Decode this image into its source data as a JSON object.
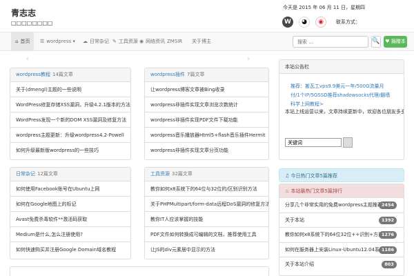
{
  "header": {
    "site_title": "青志志",
    "site_desc": "□□□□□□□□",
    "date_text": "今天是 2015 年 06 月 11 日，星期四",
    "social_label": "联系方式：",
    "social_icons": [
      "wordpress-icon",
      "qq-icon",
      "weibo-icon"
    ]
  },
  "nav": {
    "items": [
      {
        "label": "首页",
        "icon": "⌂"
      },
      {
        "label": "wordpress ▾",
        "icon": "☰"
      },
      {
        "label": "日常杂记",
        "icon": "☁"
      },
      {
        "label": "工具资源",
        "icon": "✎"
      },
      {
        "label": "网络资讯",
        "icon": "◉"
      },
      {
        "label": "ZMSIR",
        "icon": ""
      },
      {
        "label": "关于博主",
        "icon": ""
      }
    ],
    "search_placeholder": "搜索 ...",
    "search_icon": "🔍",
    "donate_label": "♥ 捐赠本站"
  },
  "arrows": {
    "left": "‹",
    "right": "›"
  },
  "panels": [
    {
      "title": "wordpress",
      "title_suffix": "教程",
      "count": "14篇文章",
      "rows": [
        "关于(dmengl)主题的一些说明",
        "WordPress修复存储XSS漏洞，升级4.2.1版本的方法",
        "WordPress发现一个新的DOM XSS漏洞及修复方法",
        "wordpress主题更新：升级wordpress4.2-Powell",
        "如何升级最新版wordpress的一些技巧"
      ]
    },
    {
      "title": "wordpress",
      "title_suffix": "插件",
      "count": "7篇文章",
      "rows": [
        "让wordpress博客文章被Bing收录",
        "wordpress非插件实现文章浏览次数统计",
        "wordpress非插件实现PDF文件下载功能",
        "wordpress音乐播放器Html5+flash音乐插件Hermit",
        "wordpress非插件实现文章分页功能"
      ]
    },
    {
      "title": "日常杂记",
      "title_suffix": "",
      "count": "12篇文章",
      "rows": [
        "如何使用Facebook账号在Ubuntu上网",
        "如何在Google地图上的标记",
        "Avast免费杀毒软件**激活码获取",
        "Medium是什么,怎么注册使用?",
        "如何快速购买并注册Google Domain域名教程"
      ]
    },
    {
      "title": "工具资源",
      "title_suffix": "",
      "count": "32篇文章",
      "rows": [
        "教你如何x8系统下的64位与32位的/区别识别方法",
        "关于PHPMultipart/form-data远程DoS漏洞的修复方法介绍",
        "教你IT人应该掌握的技能",
        "PDF文件如何转换成可编辑的文档，推荐使用工具",
        "让JS的div元素居中显示的方法"
      ]
    }
  ],
  "sidebar": {
    "notice_title": "本站公告栏",
    "notice_link": "推荐：搬瓦工vps9.9美元一年/500G流量月付/1个IP/5GSSD推荐shadowsocks代理/翻墙科学上网教程>",
    "notice_text": "本站上线运营以来，文章持续更新中，欢迎各位朋友多多关注本站...",
    "input_value": "关键词",
    "hot_title": "今日热门文章5篇推荐",
    "top_title": "本站最热门文章5篇排行",
    "top_items": [
      {
        "label": "分享几个非常实用的免费wordpress主题推荐",
        "count": "2454"
      },
      {
        "label": "关于本站",
        "count": "1392"
      },
      {
        "label": "教你如何x8系统下的64位32位++识别+方法介绍",
        "count": "1276"
      },
      {
        "label": "如何在服务器上安装Linux-Ubuntu12.04系统",
        "count": "1186"
      },
      {
        "label": "关于本站介绍",
        "count": "803"
      }
    ]
  }
}
